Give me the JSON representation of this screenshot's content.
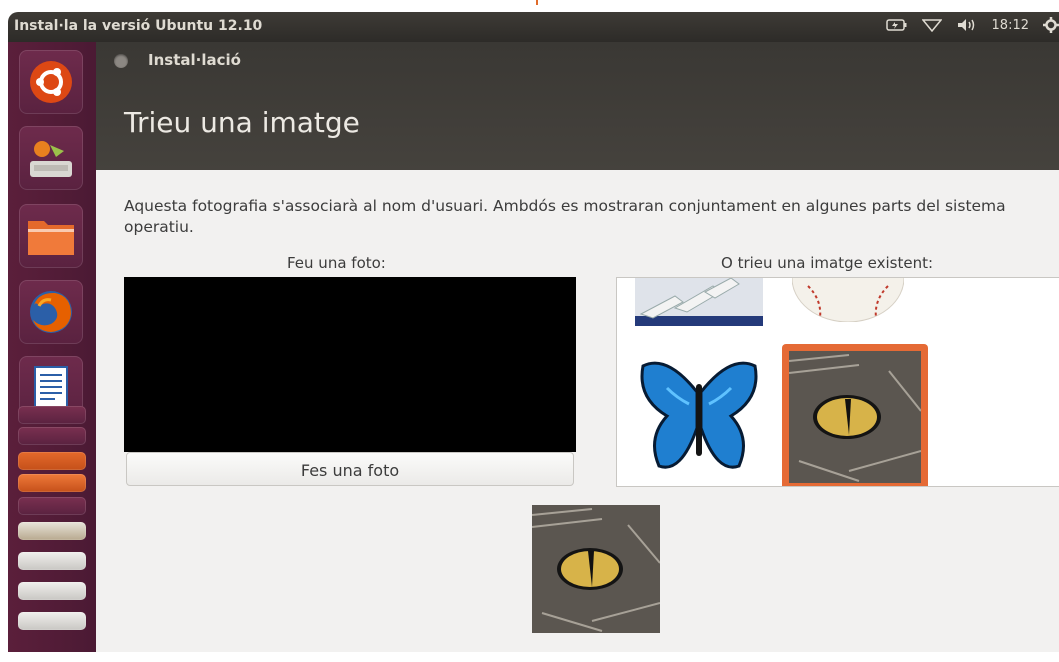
{
  "panel": {
    "app_title": "Instal·la la versió Ubuntu 12.10",
    "clock": "18:12",
    "icons": [
      "battery-icon",
      "network-icon",
      "volume-icon",
      "session-gear-icon"
    ]
  },
  "launcher": {
    "items": [
      "ubuntu-dash-icon",
      "installer-icon",
      "files-folder-icon",
      "firefox-icon",
      "libreoffice-writer-icon",
      "libreoffice-calc-icon",
      "libreoffice-impress-icon",
      "software-center-icon",
      "workspace-switcher-icon"
    ]
  },
  "window": {
    "title": "Instal·lació",
    "heading": "Trieu una imatge",
    "description": "Aquesta fotografia s'associarà al nom d'usuari. Ambdós es mostraran conjuntament en algunes parts del sistema operatiu.",
    "take_photo_label": "Feu una foto:",
    "take_photo_button": "Fes una foto",
    "existing_label": "O trieu una imatge existent:",
    "images": [
      "astronaut-gloves",
      "baseball",
      "butterfly",
      "cat-eye"
    ],
    "selected_image": "cat-eye",
    "colors": {
      "accent": "#e56a35",
      "launcher": "#5b1f3b",
      "header": "#3a3834"
    }
  }
}
